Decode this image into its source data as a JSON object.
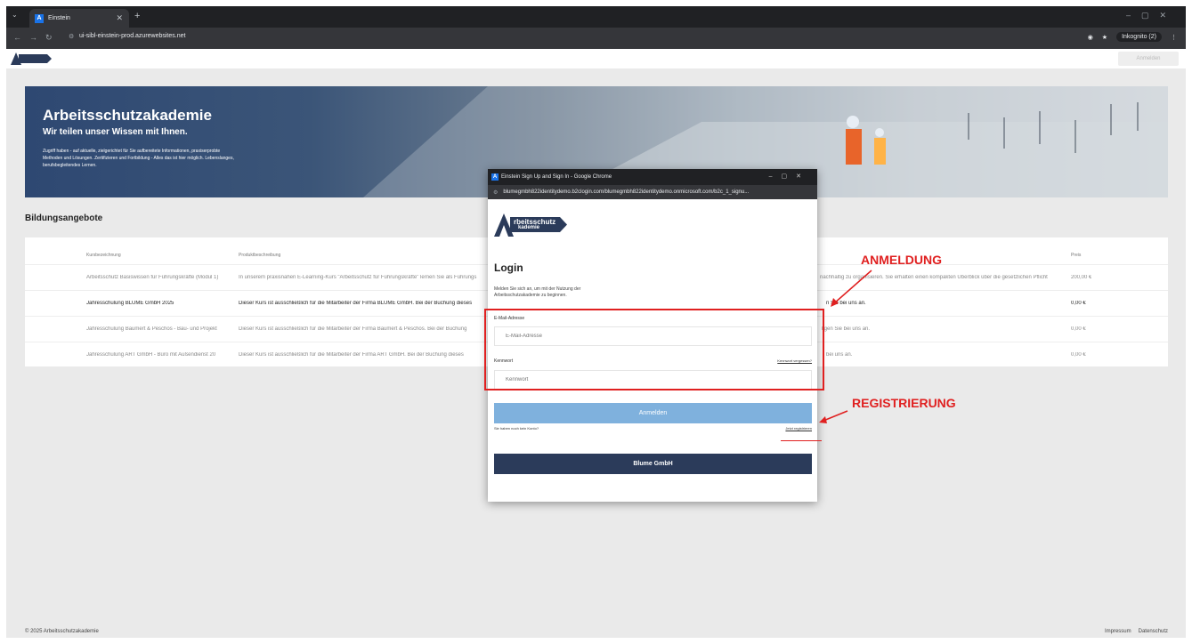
{
  "browser": {
    "tab_title": "Einstein",
    "url": "ui-sibl-einstein-prod.azurewebsites.net",
    "incognito_label": "Inkognito (2)"
  },
  "site": {
    "header_button": "Anmelden",
    "hero": {
      "title": "Arbeitsschutzakademie",
      "subtitle": "Wir teilen unser Wissen mit Ihnen.",
      "text": "Zugriff haben - auf aktuelle, zielgerichtet für Sie aufbereitete Informationen, praxiserprobte Methoden und Lösungen. Zertifizieren und Fortbildung - Alles das ist hier möglich. Lebenslanges, berufsbegleitendes Lernen."
    },
    "section_title": "Bildungsangebote",
    "table": {
      "headers": [
        "Kursbezeichnung",
        "Produktbeschreibung",
        "Preis"
      ],
      "rows": [
        {
          "name": "Arbeitsschutz Basiswissen für Führungskräfte (Modul 1)",
          "desc": "In unserem praxisnahen E-Learning-Kurs \"Arbeitsschutz für Führungskräfte\" lernen Sie als Führungs",
          "desc_end": "nachhaltig zu organisieren. Sie erhalten einen kompakten Überblick über die gesetzlichen Pflicht",
          "price": "200,00 €"
        },
        {
          "name": "Jahresschulung BLUME GmbH 2025",
          "desc": "Dieser Kurs ist ausschließlich für die Mitarbeiter der Firma BLUME GmbH. Bei der Buchung dieses",
          "desc_end": "n Sie bei uns an.",
          "price": "0,00 €"
        },
        {
          "name": "Jahresschulung Baumert & Peschos - Bau- und Projekt",
          "desc": "Dieser Kurs ist ausschließlich für die Mitarbeiter der Firma Baumert & Peschos. Bei der Buchung",
          "desc_end": "ligen Sie bei uns an.",
          "price": "0,00 €"
        },
        {
          "name": "Jahresschulung ART GmbH - Büro mit Außendienst 20",
          "desc": "Dieser Kurs ist ausschließlich für die Mitarbeiter der Firma ART GmbH. Bei der Buchung dieses",
          "desc_end": "bei uns an.",
          "price": "0,00 €"
        }
      ]
    },
    "footer": {
      "copyright": "© 2025 Arbeitsschutzakademie",
      "impressum": "Impressum",
      "datenschutz": "Datenschutz"
    }
  },
  "popup": {
    "window_title": "Einstein Sign Up and Sign In - Google Chrome",
    "url": "blumegmbh822identitydemo.b2clogin.com/blumegmbh822identitydemo.onmicrosoft.com/b2c_1_signu...",
    "logo_line1": "rbeitsschutz",
    "logo_line2": "kademie",
    "heading": "Login",
    "intro": "Melden Sie sich an, um mit der Nutzung der Arbeitsschutzakademie zu beginnen.",
    "email_label": "E-Mail-Adresse",
    "email_placeholder": "E-Mail-Adresse",
    "password_label": "Kennwort",
    "password_placeholder": "Kennwort",
    "forgot_link": "Kennwort vergessen?",
    "login_button": "Anmelden",
    "no_account_text": "Sie haben noch kein Konto?",
    "register_link": "Jetzt registrieren",
    "blume_button": "Blume GmbH"
  },
  "annotations": {
    "login_label": "ANMELDUNG",
    "register_label": "REGISTRIERUNG",
    "color": "#e02020"
  }
}
